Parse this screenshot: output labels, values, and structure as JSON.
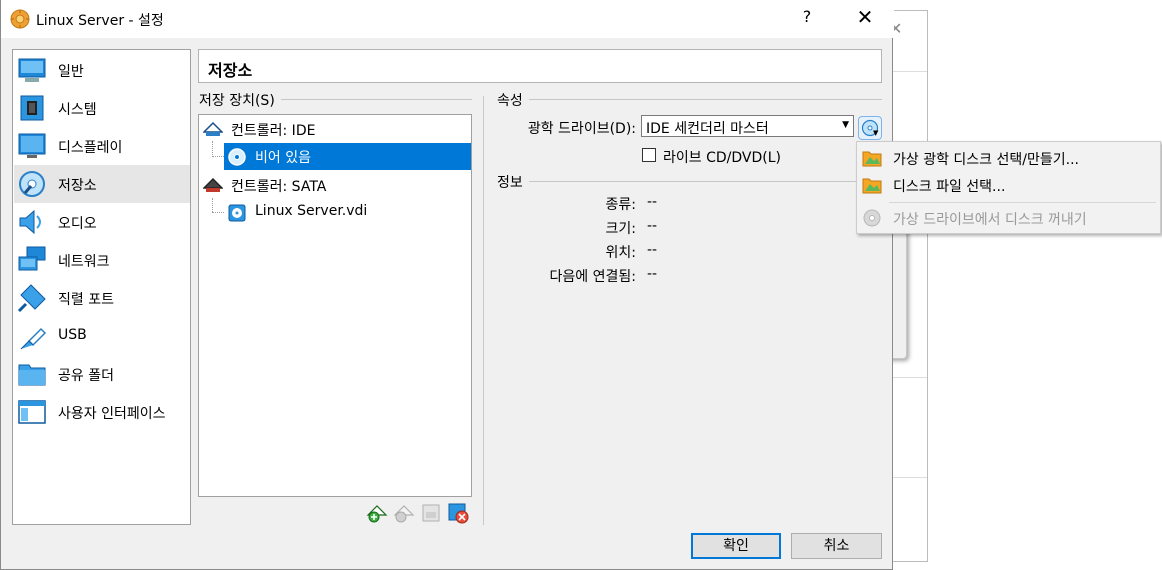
{
  "window": {
    "title": "Linux Server - 설정",
    "help_label": "?",
    "close_label": "✕"
  },
  "categories": [
    {
      "label": "일반",
      "icon": "general-icon"
    },
    {
      "label": "시스템",
      "icon": "system-icon"
    },
    {
      "label": "디스플레이",
      "icon": "display-icon"
    },
    {
      "label": "저장소",
      "icon": "storage-icon",
      "selected": true
    },
    {
      "label": "오디오",
      "icon": "audio-icon"
    },
    {
      "label": "네트워크",
      "icon": "network-icon"
    },
    {
      "label": "직렬 포트",
      "icon": "serial-port-icon"
    },
    {
      "label": "USB",
      "icon": "usb-icon"
    },
    {
      "label": "공유 폴더",
      "icon": "shared-folder-icon"
    },
    {
      "label": "사용자 인터페이스",
      "icon": "user-interface-icon"
    }
  ],
  "page_heading": "저장소",
  "storage": {
    "group_title": "저장 장치(S)",
    "tree": [
      {
        "label": "컨트롤러: IDE",
        "icon": "ide-controller-icon"
      },
      {
        "label": "비어 있음",
        "icon": "optical-disc-icon",
        "selected": true
      },
      {
        "label": "컨트롤러: SATA",
        "icon": "sata-controller-icon"
      },
      {
        "label": "Linux Server.vdi",
        "icon": "hard-disk-icon"
      }
    ]
  },
  "attributes": {
    "group_title": "속성",
    "optical_drive_label": "광학 드라이브(D):",
    "optical_drive_value": "IDE 세컨더리 마스터",
    "live_cd_label": "라이브 CD/DVD(L)",
    "live_cd_checked": false
  },
  "info": {
    "group_title": "정보",
    "rows": [
      {
        "label": "종류:",
        "value": "--"
      },
      {
        "label": "크기:",
        "value": "--"
      },
      {
        "label": "위치:",
        "value": "--"
      },
      {
        "label": "다음에 연결됨:",
        "value": "--"
      }
    ]
  },
  "menu": {
    "items": [
      {
        "label": "가상 광학 디스크 선택/만들기...",
        "enabled": true
      },
      {
        "label": "디스크 파일 선택...",
        "enabled": true
      },
      {
        "label": "가상 드라이브에서 디스크 꺼내기",
        "enabled": false
      }
    ]
  },
  "buttons": {
    "ok": "확인",
    "cancel": "취소"
  },
  "colors": {
    "selection": "#0078d7",
    "dialog_bg": "#f0f0f0"
  }
}
